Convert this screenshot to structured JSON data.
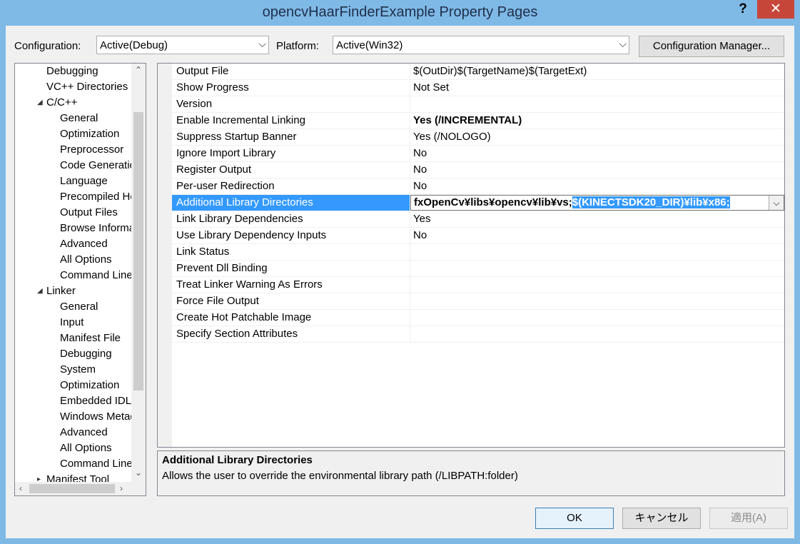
{
  "window": {
    "title": "opencvHaarFinderExample Property Pages",
    "help": "?",
    "close": "✕"
  },
  "config": {
    "label": "Configuration:",
    "value": "Active(Debug)"
  },
  "platform": {
    "label": "Platform:",
    "value": "Active(Win32)"
  },
  "config_manager_label": "Configuration Manager...",
  "tree": [
    {
      "label": "Debugging",
      "level": 1,
      "caret": ""
    },
    {
      "label": "VC++ Directories",
      "level": 1,
      "caret": ""
    },
    {
      "label": "C/C++",
      "level": 1,
      "caret": "◢"
    },
    {
      "label": "General",
      "level": 2,
      "caret": ""
    },
    {
      "label": "Optimization",
      "level": 2,
      "caret": ""
    },
    {
      "label": "Preprocessor",
      "level": 2,
      "caret": ""
    },
    {
      "label": "Code Generation",
      "level": 2,
      "caret": ""
    },
    {
      "label": "Language",
      "level": 2,
      "caret": ""
    },
    {
      "label": "Precompiled Headers",
      "level": 2,
      "caret": ""
    },
    {
      "label": "Output Files",
      "level": 2,
      "caret": ""
    },
    {
      "label": "Browse Information",
      "level": 2,
      "caret": ""
    },
    {
      "label": "Advanced",
      "level": 2,
      "caret": ""
    },
    {
      "label": "All Options",
      "level": 2,
      "caret": ""
    },
    {
      "label": "Command Line",
      "level": 2,
      "caret": ""
    },
    {
      "label": "Linker",
      "level": 1,
      "caret": "◢"
    },
    {
      "label": "General",
      "level": 2,
      "caret": ""
    },
    {
      "label": "Input",
      "level": 2,
      "caret": ""
    },
    {
      "label": "Manifest File",
      "level": 2,
      "caret": ""
    },
    {
      "label": "Debugging",
      "level": 2,
      "caret": ""
    },
    {
      "label": "System",
      "level": 2,
      "caret": ""
    },
    {
      "label": "Optimization",
      "level": 2,
      "caret": ""
    },
    {
      "label": "Embedded IDL",
      "level": 2,
      "caret": ""
    },
    {
      "label": "Windows Metadata",
      "level": 2,
      "caret": ""
    },
    {
      "label": "Advanced",
      "level": 2,
      "caret": ""
    },
    {
      "label": "All Options",
      "level": 2,
      "caret": ""
    },
    {
      "label": "Command Line",
      "level": 2,
      "caret": ""
    },
    {
      "label": "Manifest Tool",
      "level": 1,
      "caret": "▸"
    }
  ],
  "properties": [
    {
      "name": "Output File",
      "value": "$(OutDir)$(TargetName)$(TargetExt)",
      "bold": false
    },
    {
      "name": "Show Progress",
      "value": "Not Set",
      "bold": false
    },
    {
      "name": "Version",
      "value": "",
      "bold": false
    },
    {
      "name": "Enable Incremental Linking",
      "value": "Yes (/INCREMENTAL)",
      "bold": true
    },
    {
      "name": "Suppress Startup Banner",
      "value": "Yes (/NOLOGO)",
      "bold": false
    },
    {
      "name": "Ignore Import Library",
      "value": "No",
      "bold": false
    },
    {
      "name": "Register Output",
      "value": "No",
      "bold": false
    },
    {
      "name": "Per-user Redirection",
      "value": "No",
      "bold": false
    },
    {
      "name": "Additional Library Directories",
      "value": "fxOpenCv¥libs¥opencv¥lib¥vs;",
      "value_selected": "$(KINECTSDK20_DIR)¥lib¥x86;",
      "bold": true,
      "selected": true
    },
    {
      "name": "Link Library Dependencies",
      "value": "Yes",
      "bold": false
    },
    {
      "name": "Use Library Dependency Inputs",
      "value": "No",
      "bold": false
    },
    {
      "name": "Link Status",
      "value": "",
      "bold": false
    },
    {
      "name": "Prevent Dll Binding",
      "value": "",
      "bold": false
    },
    {
      "name": "Treat Linker Warning As Errors",
      "value": "",
      "bold": false
    },
    {
      "name": "Force File Output",
      "value": "",
      "bold": false
    },
    {
      "name": "Create Hot Patchable Image",
      "value": "",
      "bold": false
    },
    {
      "name": "Specify Section Attributes",
      "value": "",
      "bold": false
    }
  ],
  "description": {
    "title": "Additional Library Directories",
    "text": "Allows the user to override the environmental library path (/LIBPATH:folder)"
  },
  "buttons": {
    "ok": "OK",
    "cancel": "キャンセル",
    "apply": "適用(A)"
  },
  "icons": {
    "dropdown": "chevron-down-icon",
    "scroll_up": "chevron-up-icon",
    "scroll_down": "chevron-down-icon",
    "scroll_left": "chevron-left-icon",
    "scroll_right": "chevron-right-icon"
  },
  "colors": {
    "titlebar": "#7fb9e6",
    "close": "#c7463a",
    "selection": "#3399ff"
  }
}
